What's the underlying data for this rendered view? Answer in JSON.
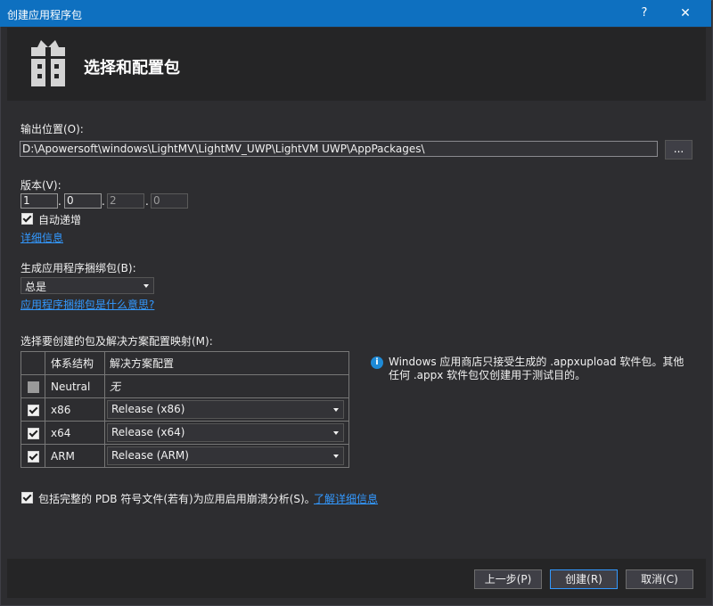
{
  "window": {
    "title": "创建应用程序包",
    "help_label": "?",
    "close_label": "✕"
  },
  "header": {
    "title": "选择和配置包",
    "icon": "gift-package-icon"
  },
  "output": {
    "label": "输出位置(O):",
    "value": "D:\\Apowersoft\\windows\\LightMV\\LightMV_UWP\\LightVM UWP\\AppPackages\\",
    "browse_label": "..."
  },
  "version": {
    "label": "版本(V):",
    "parts": [
      "1",
      "0",
      "2",
      "0"
    ],
    "auto_increment_label": "自动递增",
    "auto_increment_checked": true,
    "more_info_link": "详细信息"
  },
  "bundle": {
    "label": "生成应用程序捆绑包(B):",
    "selected": "总是",
    "help_link": "应用程序捆绑包是什么意思?"
  },
  "mapping": {
    "label": "选择要创建的包及解决方案配置映射(M):",
    "columns": [
      "体系结构",
      "解决方案配置"
    ],
    "rows": [
      {
        "arch": "Neutral",
        "config": "无",
        "checked": false,
        "dropdown": false
      },
      {
        "arch": "x86",
        "config": "Release (x86)",
        "checked": true,
        "dropdown": true
      },
      {
        "arch": "x64",
        "config": "Release (x64)",
        "checked": true,
        "dropdown": true
      },
      {
        "arch": "ARM",
        "config": "Release (ARM)",
        "checked": true,
        "dropdown": true
      }
    ]
  },
  "info": {
    "text": "Windows 应用商店只接受生成的 .appxupload 软件包。其他任何 .appx 软件包仅创建用于测试目的。"
  },
  "pdb": {
    "label": "包括完整的 PDB 符号文件(若有)为应用启用崩溃分析(S)。",
    "link": "了解详细信息",
    "checked": true
  },
  "buttons": {
    "back": "上一步(P)",
    "create": "创建(R)",
    "cancel": "取消(C)"
  },
  "colors": {
    "accent": "#0e70c0",
    "link": "#3399ff",
    "background": "#2d2d30",
    "panel": "#252526"
  }
}
